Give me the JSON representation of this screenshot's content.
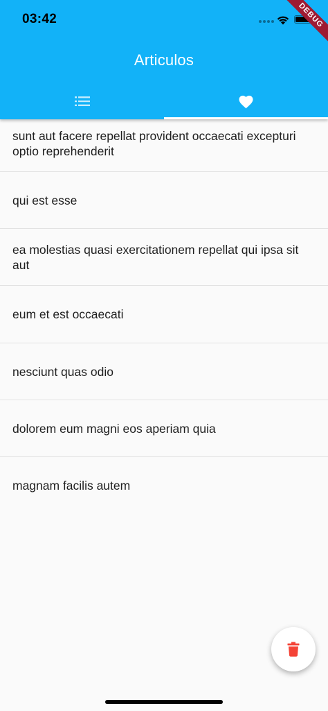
{
  "status_bar": {
    "time": "03:42",
    "debug_label": "DEBUG"
  },
  "app_bar": {
    "title": "Articulos"
  },
  "tabs": [
    {
      "icon": "list-icon",
      "active": false
    },
    {
      "icon": "heart-icon",
      "active": true
    }
  ],
  "colors": {
    "app_bar": "#12b2f8",
    "background": "#fafafa",
    "fab_icon": "#f44336",
    "debug_banner": "#9e1b32"
  },
  "articles": [
    {
      "title": "sunt aut facere repellat provident occaecati excepturi optio reprehenderit"
    },
    {
      "title": "qui est esse"
    },
    {
      "title": "ea molestias quasi exercitationem repellat qui ipsa sit aut"
    },
    {
      "title": "eum et est occaecati"
    },
    {
      "title": "nesciunt quas odio"
    },
    {
      "title": "dolorem eum magni eos aperiam quia"
    },
    {
      "title": "magnam facilis autem"
    }
  ],
  "fab": {
    "icon": "trash-icon"
  }
}
